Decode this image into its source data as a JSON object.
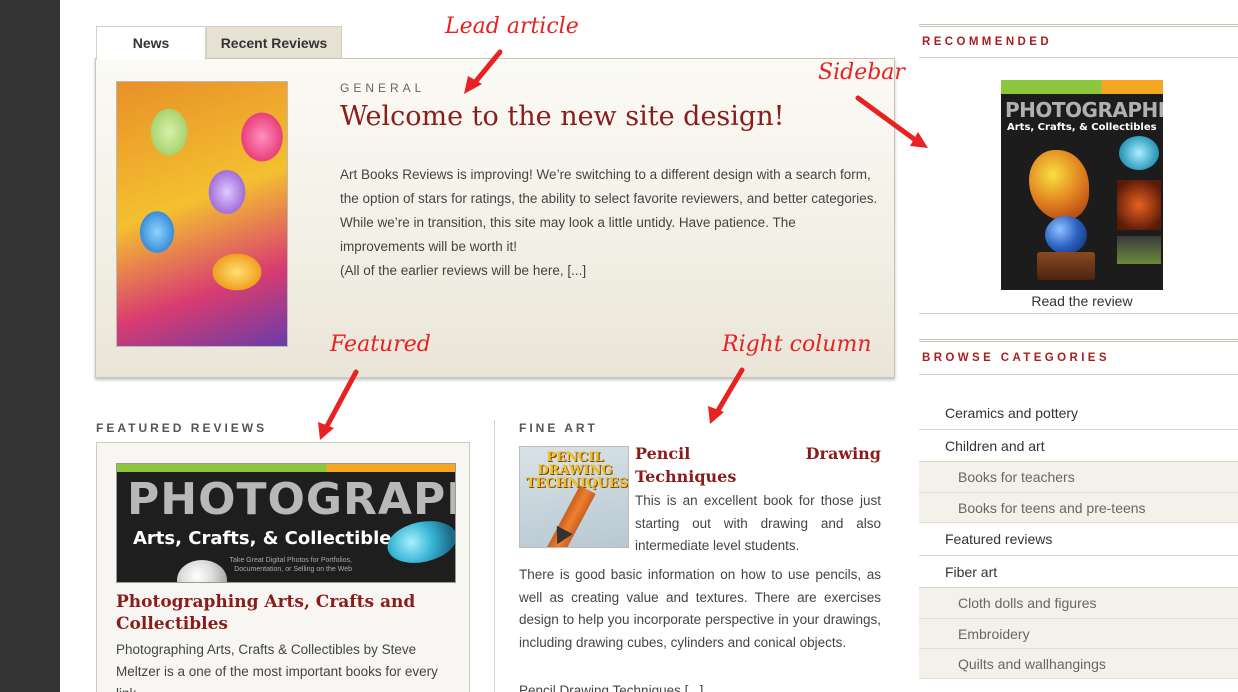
{
  "tabs": [
    {
      "label": "News"
    },
    {
      "label": "Recent Reviews"
    }
  ],
  "lead": {
    "category": "GENERAL",
    "title": "Welcome to the new site design!",
    "paragraphs": [
      "Art Books Reviews is improving!  We’re switching to a different design with a search form, the option of stars for ratings, the ability to select favorite reviewers, and better categories.",
      "While we’re in transition, this site may look a little untidy.  Have patience. The improvements will be worth it!",
      "(All of the earlier reviews will be here, [...]"
    ]
  },
  "annotations": {
    "lead": "Lead article",
    "sidebar": "Sidebar",
    "featured": "Featured",
    "right": "Right column"
  },
  "featured": {
    "heading": "FEATURED REVIEWS",
    "cover": {
      "big": "PHOTOGRAPHING",
      "sub": "Arts, Crafts, & Collectibles",
      "tagline": "Take Great Digital Photos for Portfolios, Documentation, or Selling on the Web"
    },
    "title": "Photographing Arts, Crafts and Collectibles",
    "text": "Photographing Arts, Crafts & Collectibles by Steve Meltzer is a one of the most important books for every link..."
  },
  "fineart": {
    "heading": "FINE ART",
    "thumb_title": "PENCIL DRAWING TECHNIQUES",
    "title_line1": "Pencil Drawing",
    "title_line2": "Techniques",
    "text_side": "This is an excellent book for those just starting out with drawing and also intermediate level students.",
    "text_full": "There is good basic information on how to use pencils, as well as creating value and textures. There are exercises design to help you incorporate perspective in your drawings, including drawing cubes, cylinders and conical objects.",
    "more": "Pencil Drawing Techniques [...]"
  },
  "sidebar": {
    "recommended_heading": "RECOMMENDED",
    "recommended_cover": {
      "big": "PHOTOGRAPHING",
      "sub": "Arts, Crafts, & Collectibles"
    },
    "recommended_link": "Read the review",
    "categories_heading": "BROWSE CATEGORIES",
    "categories": [
      {
        "label": "Ceramics and pottery",
        "level": "top"
      },
      {
        "label": "Children and art",
        "level": "top"
      },
      {
        "label": "Books for teachers",
        "level": "sub"
      },
      {
        "label": "Books for teens and pre-teens",
        "level": "sub"
      },
      {
        "label": "Featured reviews",
        "level": "top"
      },
      {
        "label": "Fiber art",
        "level": "top"
      },
      {
        "label": "Cloth dolls and figures",
        "level": "sub"
      },
      {
        "label": "Embroidery",
        "level": "sub"
      },
      {
        "label": "Quilts and wallhangings",
        "level": "sub"
      }
    ]
  },
  "colors": {
    "accent_red": "#8a1c1c",
    "annotation_red": "#e82222",
    "sidebar_heading": "#a8201e"
  }
}
